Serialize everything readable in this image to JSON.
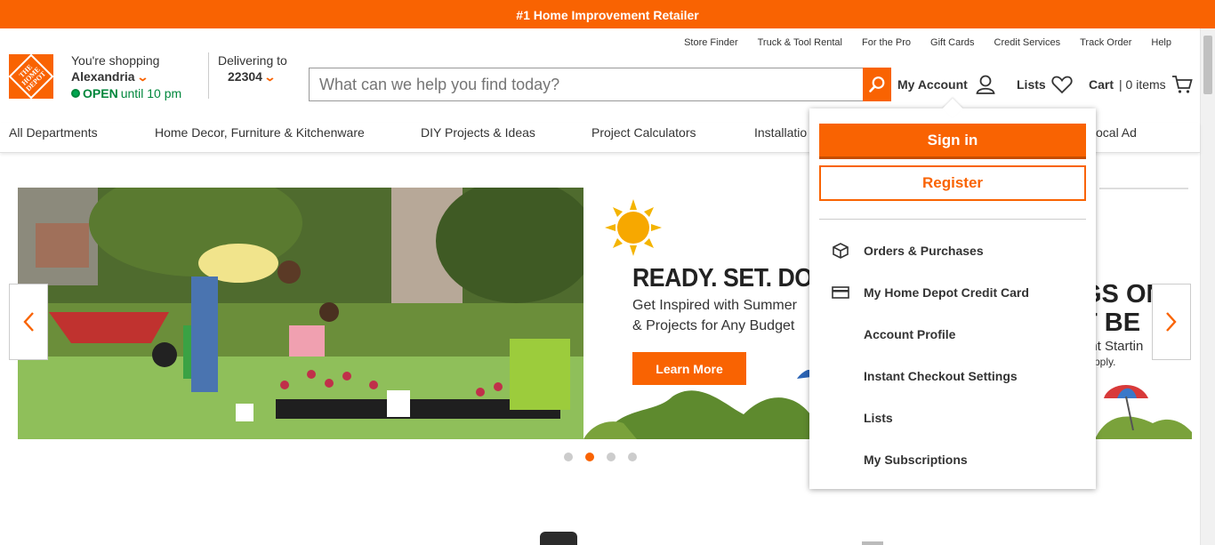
{
  "promo": {
    "text": "#1 Home Improvement Retailer"
  },
  "utility_links": [
    "Store Finder",
    "Truck & Tool Rental",
    "For the Pro",
    "Gift Cards",
    "Credit Services",
    "Track Order",
    "Help"
  ],
  "logo": {
    "text": "THE HOME DEPOT"
  },
  "store": {
    "label": "You're shopping",
    "city": "Alexandria",
    "status": "OPEN",
    "hours": "until 10 pm"
  },
  "delivery": {
    "label": "Delivering to",
    "zip": "22304"
  },
  "search": {
    "placeholder": "What can we help you find today?"
  },
  "account": {
    "label": "My Account"
  },
  "lists": {
    "label": "Lists"
  },
  "cart": {
    "label": "Cart",
    "count": "| 0 items"
  },
  "nav": [
    "All Departments",
    "Home Decor, Furniture & Kitchenware",
    "DIY Projects & Ideas",
    "Project Calculators",
    "Installatio",
    "ocal Ad"
  ],
  "hero": {
    "headline": "READY. SET. DO.",
    "subline1": "Get Inspired with Summer",
    "subline2": "& Projects for Any Budget",
    "cta": "Learn More",
    "partial_headline_1": "GS ON",
    "partial_headline_2": "T BE",
    "partial_sub1": "int Startin",
    "partial_sub2": "pply."
  },
  "carousel": {
    "dots": 4,
    "active": 2
  },
  "account_menu": {
    "signin": "Sign in",
    "register": "Register",
    "items": [
      {
        "label": "Orders & Purchases",
        "icon": "box-icon"
      },
      {
        "label": "My Home Depot Credit Card",
        "icon": "credit-card-icon"
      },
      {
        "label": "Account Profile",
        "icon": ""
      },
      {
        "label": "Instant Checkout Settings",
        "icon": ""
      },
      {
        "label": "Lists",
        "icon": ""
      },
      {
        "label": "My Subscriptions",
        "icon": ""
      }
    ]
  },
  "colors": {
    "brand": "#f96302",
    "open": "#00873c"
  }
}
